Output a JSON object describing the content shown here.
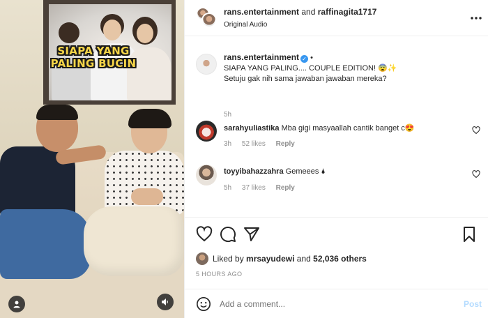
{
  "video": {
    "overlay_line1": "SIAPA YANG",
    "overlay_line2": "PALING BUCIN"
  },
  "header": {
    "user_primary": "rans.entertainment",
    "joiner": "and",
    "user_secondary": "raffinagita1717",
    "audio_label": "Original Audio",
    "more_icon": "more-horizontal-icon"
  },
  "caption": {
    "username": "rans.entertainment",
    "verified": true,
    "dot": "•",
    "line1": "SIAPA YANG PALING.... COUPLE EDITION! 😨✨",
    "line2": "Setuju gak nih sama jawaban jawaban mereka?",
    "time": "5h"
  },
  "comments": [
    {
      "username": "sarahyuliastika",
      "text": "Mba gigi masyaallah cantik banget c😍",
      "time": "3h",
      "likes": "52 likes",
      "reply": "Reply"
    },
    {
      "username": "toyyibahazzahra",
      "text": "Gemeees 🌢",
      "time": "5h",
      "likes": "37 likes",
      "reply": "Reply"
    }
  ],
  "actions": {
    "like_icon": "heart-icon",
    "comment_icon": "comment-bubble-icon",
    "share_icon": "paper-plane-icon",
    "save_icon": "bookmark-icon"
  },
  "likes": {
    "prefix": "Liked by",
    "user": "mrsayudewi",
    "joiner": "and",
    "others": "52,036 others"
  },
  "post_time": "5 HOURS AGO",
  "composer": {
    "placeholder": "Add a comment...",
    "post_label": "Post"
  },
  "colors": {
    "text": "#262626",
    "muted": "#8e8e8e",
    "verified": "#3897f0",
    "post_disabled": "#b3dbff",
    "overlay_text": "#f6d548"
  }
}
